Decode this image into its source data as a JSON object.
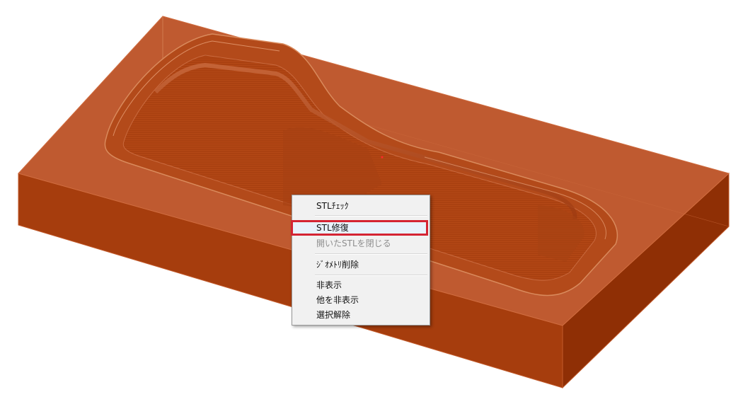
{
  "context_menu": {
    "items": [
      {
        "label": "STLﾁｪｯｸ",
        "state": "normal"
      },
      {
        "label": "STL修復",
        "state": "highlighted"
      },
      {
        "label": "開いたSTLを閉じる",
        "state": "disabled"
      },
      {
        "label": "ｼﾞｵﾒﾄﾘ削除",
        "state": "normal"
      },
      {
        "label": "非表示",
        "state": "normal"
      },
      {
        "label": "他を非表示",
        "state": "normal"
      },
      {
        "label": "選択解除",
        "state": "normal"
      }
    ]
  },
  "colors": {
    "block_top": "#bf5a30",
    "block_front": "#a63d0d",
    "block_side": "#8f2f05",
    "cavity": "#b24614",
    "highlight_box": "#d42433"
  }
}
